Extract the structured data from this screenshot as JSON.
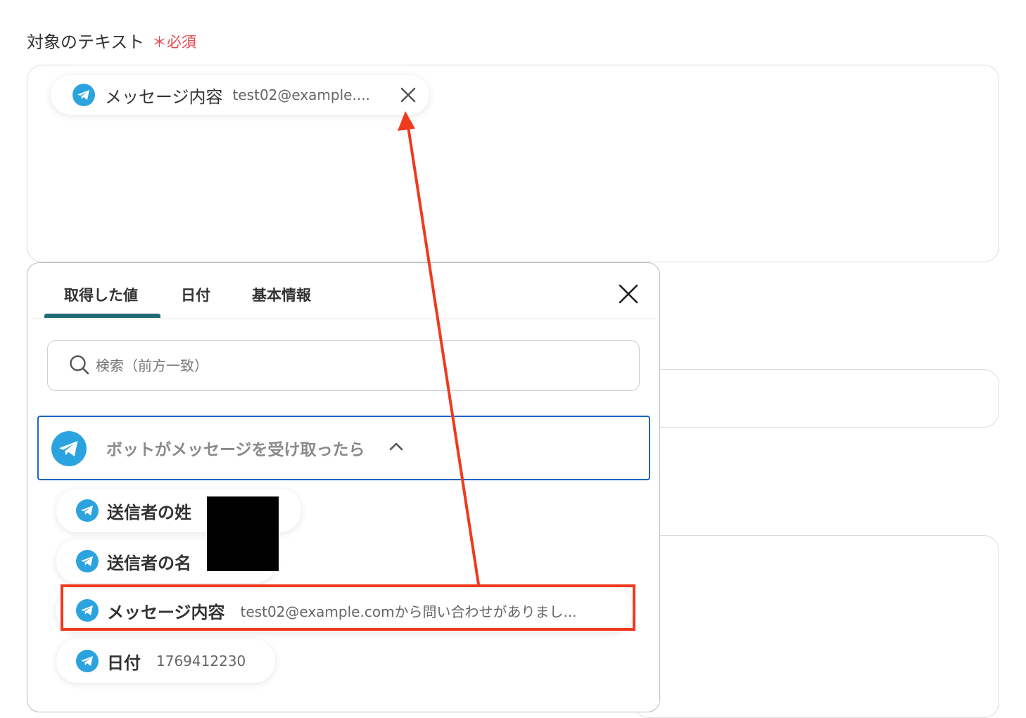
{
  "field": {
    "label": "対象のテキスト",
    "required": "＊必須"
  },
  "selected_chip": {
    "label": "メッセージ内容",
    "value": "test02@example...."
  },
  "panel": {
    "tabs": [
      "取得した値",
      "日付",
      "基本情報"
    ],
    "active_tab": "取得した値",
    "search": {
      "placeholder": "検索（前方一致）",
      "value": ""
    },
    "group": {
      "label": "ボットがメッセージを受け取ったら",
      "expanded": true
    },
    "items": [
      {
        "label": "送信者の姓",
        "value": ""
      },
      {
        "label": "送信者の名",
        "value": ""
      },
      {
        "label": "メッセージ内容",
        "value": "test02@example.comから問い合わせがありまし..."
      },
      {
        "label": "日付",
        "value": "1769412230"
      }
    ]
  },
  "colors": {
    "telegram": "#2aa3df",
    "required": "#e5484d",
    "tab_underline": "#1f6a75",
    "group_border": "#1a66c9",
    "annotation": "#ef3a1d"
  },
  "icons": [
    "telegram-icon",
    "close-icon",
    "search-icon",
    "chevron-up-icon"
  ]
}
